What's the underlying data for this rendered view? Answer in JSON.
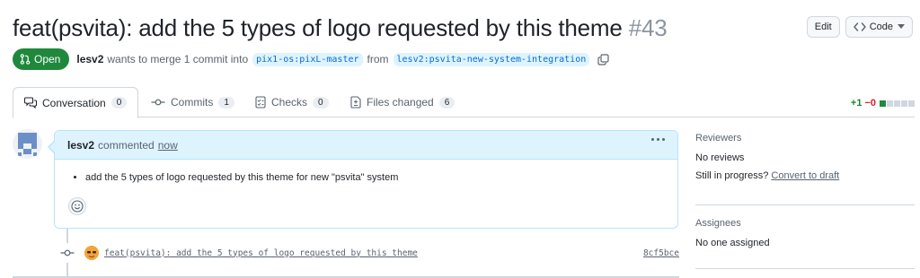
{
  "pr": {
    "title": "feat(psvita): add the 5 types of logo requested by this theme",
    "number": "#43",
    "state_label": "Open",
    "author": "lesv2",
    "merge_text": "wants to merge 1 commit into",
    "base_branch": "pix1-os:pixL-master",
    "from_text": "from",
    "head_branch": "lesv2:psvita-new-system-integration"
  },
  "header_buttons": {
    "edit_label": "Edit",
    "code_label": "Code"
  },
  "tabs": [
    {
      "label": "Conversation",
      "count": "0"
    },
    {
      "label": "Commits",
      "count": "1"
    },
    {
      "label": "Checks",
      "count": "0"
    },
    {
      "label": "Files changed",
      "count": "6"
    }
  ],
  "diffstat": {
    "additions": "+1",
    "deletions": "−0"
  },
  "comment": {
    "author": "lesv2",
    "action": "commented",
    "time": "now",
    "body_item": "add the 5 types of logo requested by this theme for new \"psvita\" system"
  },
  "commit": {
    "message": "feat(psvita): add the 5 types of logo requested by this theme",
    "sha": "8cf5bce"
  },
  "sidebar": {
    "reviewers_heading": "Reviewers",
    "reviewers_value": "No reviews",
    "progress_text": "Still in progress?",
    "progress_link": "Convert to draft",
    "assignees_heading": "Assignees",
    "assignees_value": "No one assigned"
  },
  "colors": {
    "open_green": "#1f883d",
    "link_blue": "#0969da",
    "comment_header_bg": "#ddf4ff"
  }
}
